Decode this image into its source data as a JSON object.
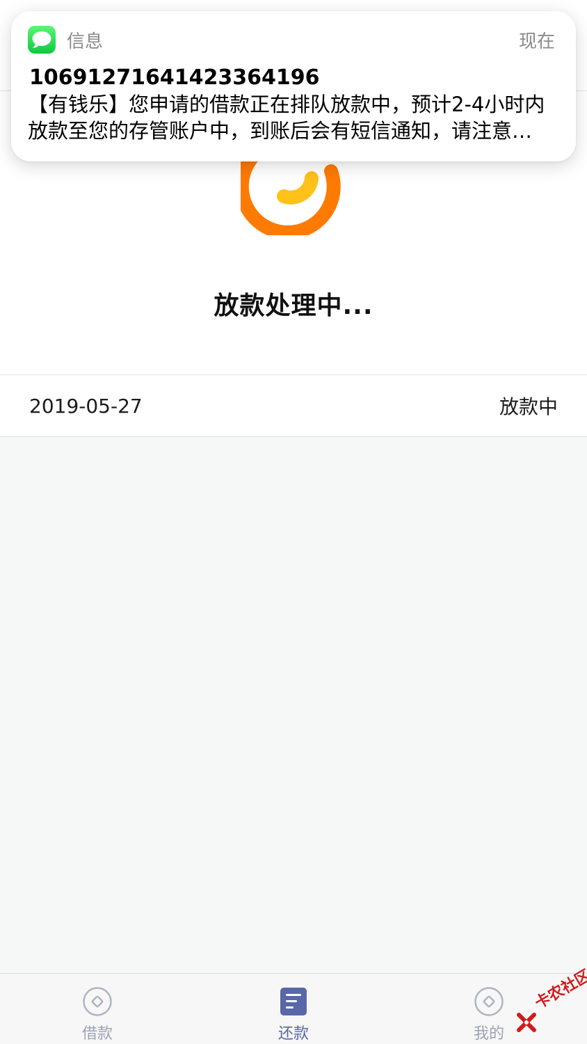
{
  "notification": {
    "app_name": "信息",
    "time": "现在",
    "sender": "106912716414233641‌96",
    "body": "【有钱乐】您申请的借款正在排队放款中，预计2-4小时内放款至您的存管账户中，到账后会有短信通知，请注意查收。"
  },
  "loan_status": {
    "title": "放款处理中...",
    "record_date": "2019-05-27",
    "record_status": "放款中"
  },
  "tabbar": {
    "tabs": [
      {
        "label": "借款",
        "icon": "circle-coin-icon",
        "active": false
      },
      {
        "label": "还款",
        "icon": "document-list-icon",
        "active": true
      },
      {
        "label": "我的",
        "icon": "circle-coin-icon",
        "active": false
      }
    ]
  },
  "watermark": {
    "text": "卡农社区"
  },
  "colors": {
    "spinner_outer": "#ff7a00",
    "spinner_inner": "#ffc21a",
    "tab_active": "#5867a7",
    "tab_inactive": "#9da3b3",
    "message_icon": "#1fd14a"
  }
}
